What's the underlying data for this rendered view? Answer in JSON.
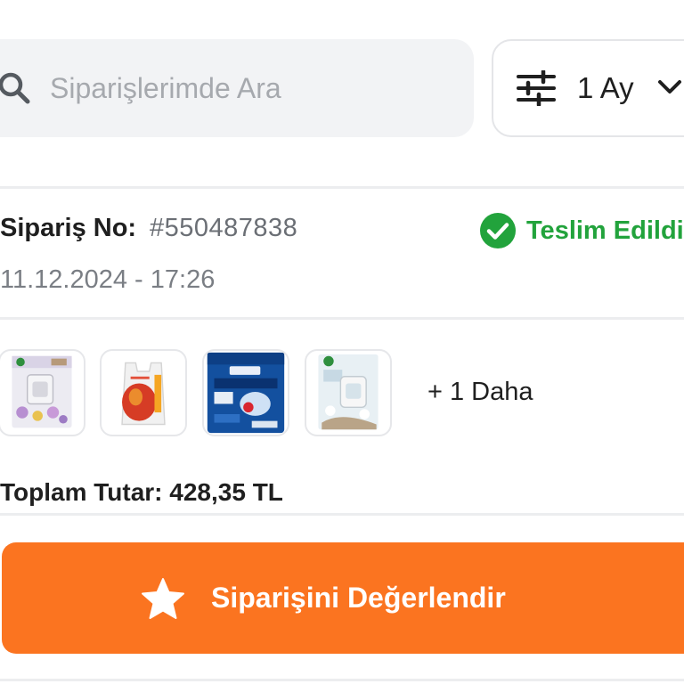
{
  "search": {
    "placeholder": "Siparişlerimde Ara",
    "icon": "search-icon"
  },
  "filter": {
    "label": "1 Ay",
    "icon": "sliders-icon",
    "dropdown_icon": "chevron-down-icon"
  },
  "order": {
    "number_label": "Sipariş No:",
    "number_value": "#550487838",
    "date": "11.12.2024 - 17:26",
    "status": {
      "text": "Teslim Edildi",
      "icon": "check-circle-icon",
      "color": "#22a33c"
    },
    "products": [
      {
        "name": "air-freshener-lavender",
        "icon": "product-thumbnail-icon"
      },
      {
        "name": "shopping-bag",
        "icon": "product-thumbnail-icon"
      },
      {
        "name": "finish-quantum-36",
        "icon": "product-thumbnail-icon"
      },
      {
        "name": "air-freshener-cotton",
        "icon": "product-thumbnail-icon"
      }
    ],
    "more_items": "+ 1 Daha",
    "total": "Toplam Tutar: 428,35 TL"
  },
  "rate_button": {
    "label": "Siparişini Değerlendir",
    "icon": "star-icon",
    "color": "#fb7420"
  }
}
